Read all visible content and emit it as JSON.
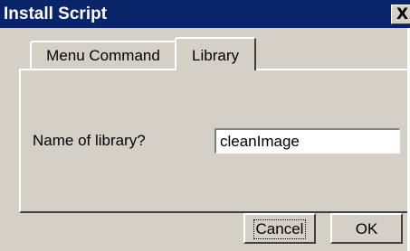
{
  "window": {
    "title": "Install Script",
    "close_glyph": "X",
    "close_icon": "close-icon"
  },
  "tabs": [
    {
      "label": "Menu Command",
      "selected": false
    },
    {
      "label": "Library",
      "selected": true
    }
  ],
  "form": {
    "library_label": "Name of library?",
    "library_value": "cleanImage"
  },
  "buttons": {
    "cancel_label": "Cancel",
    "ok_label": "OK"
  },
  "colors": {
    "titlebar": "#0a246a",
    "face": "#d4d0c8"
  }
}
